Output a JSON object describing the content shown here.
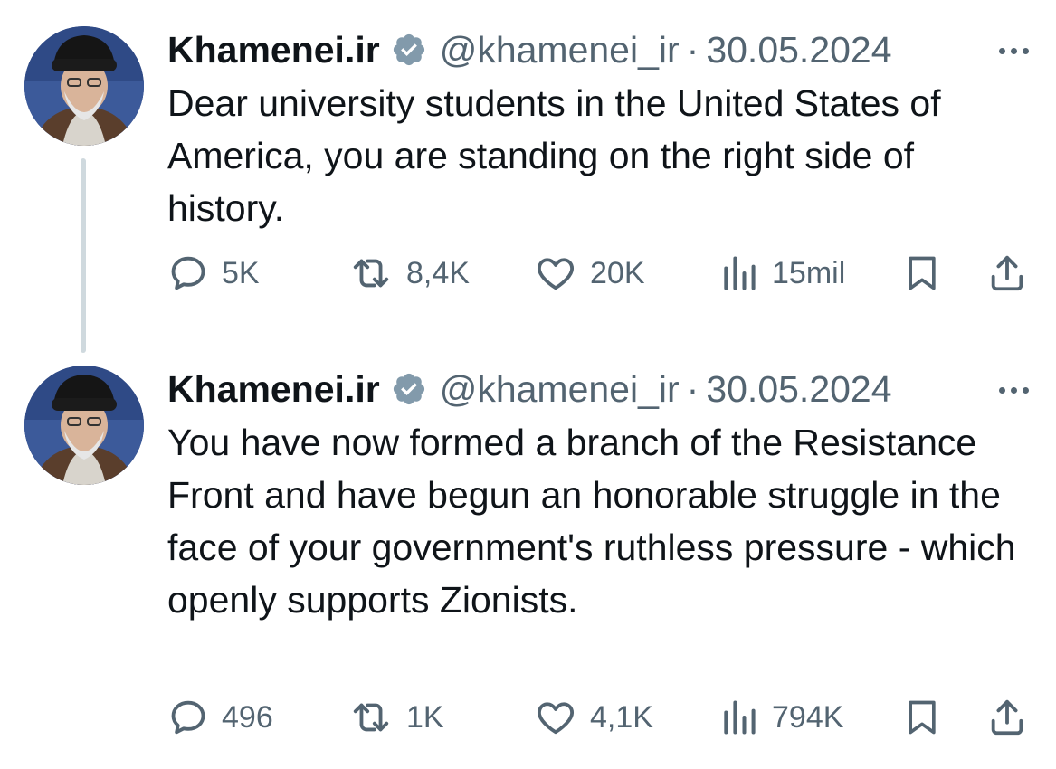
{
  "tweets": [
    {
      "author_name": "Khamenei.ir",
      "handle": "@khamenei_ir",
      "separator": "·",
      "date": "30.05.2024",
      "text": "Dear university students in the United States of America, you are standing on the right side of history.",
      "replies": "5K",
      "reposts": "8,4K",
      "likes": "20K",
      "views": "15mil"
    },
    {
      "author_name": "Khamenei.ir",
      "handle": "@khamenei_ir",
      "separator": "·",
      "date": "30.05.2024",
      "text": "You have now formed a branch of the Resistance Front and have begun an honorable struggle in the face of your government's ruthless pressure - which openly supports Zionists.",
      "replies": "496",
      "reposts": "1K",
      "likes": "4,1K",
      "views": "794K"
    }
  ],
  "colors": {
    "text": "#0f1419",
    "secondary": "#536471",
    "thread_line": "#cfd9de",
    "verified_badge": "#829aab"
  },
  "icons": {
    "reply": "speech-bubble-icon",
    "repost": "repost-arrows-icon",
    "like": "heart-icon",
    "views": "bar-chart-icon",
    "bookmark": "bookmark-icon",
    "share": "share-upload-icon",
    "verified": "verified-badge-icon",
    "more": "more-dots-icon"
  }
}
